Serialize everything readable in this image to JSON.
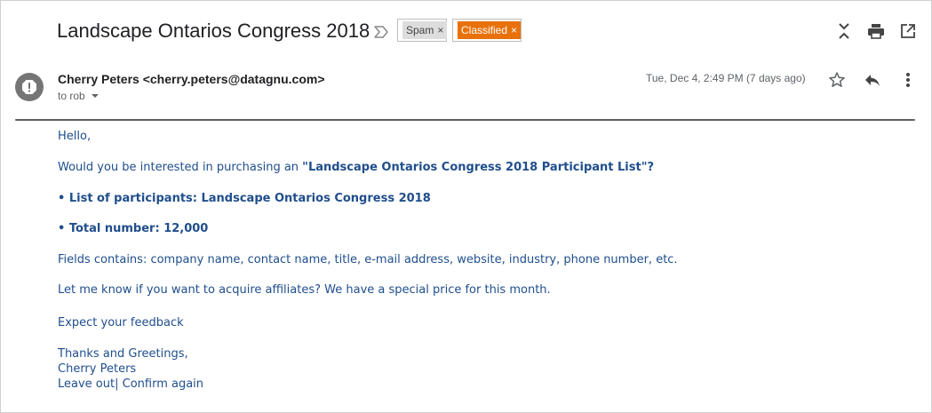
{
  "email": {
    "subject": "Landscape Ontarios Congress 2018",
    "labels": [
      {
        "text": "Spam",
        "remove": "×"
      },
      {
        "text": "Classified",
        "remove": "×"
      }
    ],
    "sender": "Cherry Peters <cherry.peters@datagnu.com>",
    "recipient": "to rob",
    "date": "Tue, Dec 4, 2:49 PM (7 days ago)",
    "body": {
      "greeting": "Hello,",
      "question_prefix": "Would you be interested in purchasing an ",
      "question_bold": "\"Landscape Ontarios Congress 2018 Participant List\"?",
      "bullet1": "• List of participants: Landscape Ontarios Congress 2018",
      "bullet2": "• Total number: 12,000",
      "fields": "Fields contains: company name, contact name, title, e-mail address, website, industry, phone number, etc.",
      "affiliates": "Let me know if you want to acquire affiliates? We have a special price for this month.",
      "expect": "Expect your feedback",
      "thanks": "Thanks and Greetings,",
      "signature": "Cherry Peters",
      "leave_out": "Leave out",
      "separator": "|",
      "confirm": " Confirm again"
    }
  },
  "colors": {
    "body_text": "#1f4e8c",
    "classified_label": "#e8710a",
    "spam_label": "#dddddd",
    "avatar": "#757575"
  },
  "icons": [
    "important-marker-icon",
    "collapse-icon",
    "print-icon",
    "open-new-window-icon",
    "spam-alert-icon",
    "dropdown-arrow-icon",
    "star-icon",
    "reply-icon",
    "more-vert-icon"
  ]
}
